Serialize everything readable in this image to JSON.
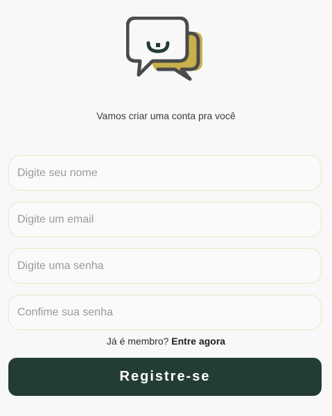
{
  "header": {
    "logo_icon": "chat-bubbles-smile-logo-icon",
    "subtitle": "Vamos criar uma conta pra você"
  },
  "form": {
    "name_placeholder": "Digite seu nome",
    "email_placeholder": "Digite um email",
    "password_placeholder": "Digite uma senha",
    "confirm_placeholder": "Confime sua senha"
  },
  "footer": {
    "member_question": "Já é membro?",
    "login_link": "Entre agora",
    "register_button": "Registre-se"
  },
  "colors": {
    "background": "#f8f8f8",
    "button": "#243d33",
    "field_border": "#e6e8c7",
    "logo_dark": "#4a4a4e",
    "logo_gold": "#c9b04b",
    "logo_smile": "#243d33"
  }
}
